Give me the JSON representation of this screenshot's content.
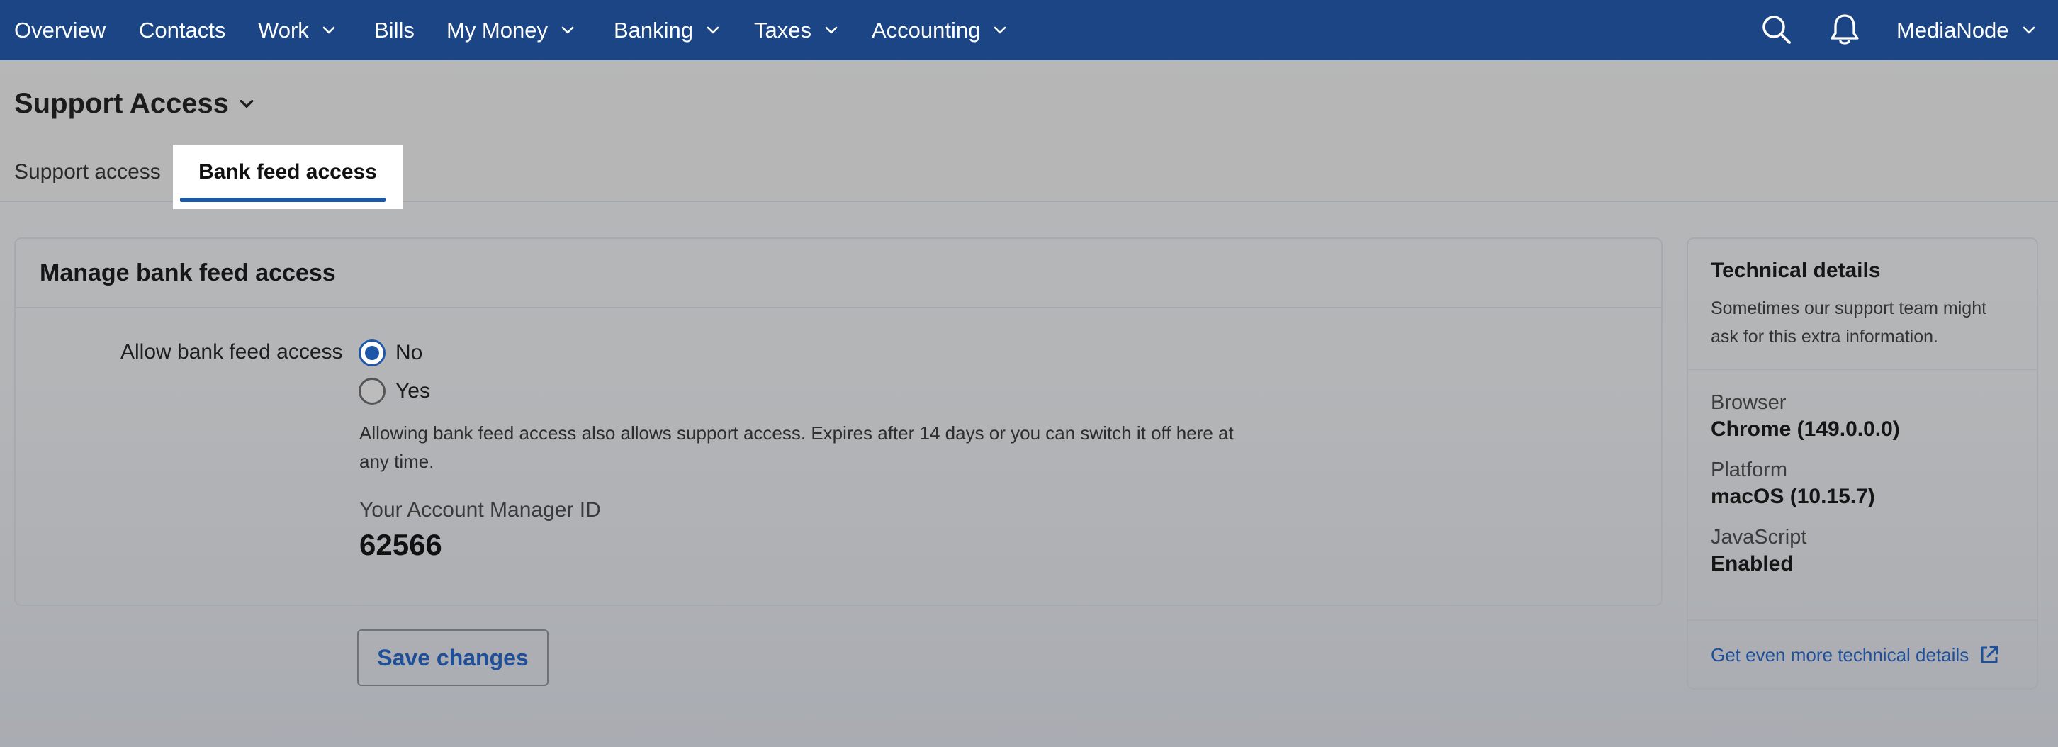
{
  "nav": {
    "items": [
      {
        "label": "Overview",
        "dropdown": false
      },
      {
        "label": "Contacts",
        "dropdown": false
      },
      {
        "label": "Work",
        "dropdown": true
      },
      {
        "label": "Bills",
        "dropdown": false
      },
      {
        "label": "My Money",
        "dropdown": true
      },
      {
        "label": "Banking",
        "dropdown": true
      },
      {
        "label": "Taxes",
        "dropdown": true
      },
      {
        "label": "Accounting",
        "dropdown": true
      }
    ],
    "account_label": "MediaNode",
    "icons": [
      "search-icon",
      "bell-icon",
      "chevron-down-icon"
    ],
    "bg_color": "#1b4585"
  },
  "page": {
    "title": "Support Access"
  },
  "tabs": [
    {
      "label": "Support access",
      "active": false
    },
    {
      "label": "Bank feed access",
      "active": true
    }
  ],
  "card": {
    "heading": "Manage bank feed access",
    "field_label": "Allow bank feed access",
    "options": [
      {
        "label": "No",
        "checked": true
      },
      {
        "label": "Yes",
        "checked": false
      }
    ],
    "help_text": "Allowing bank feed access also allows support access. Expires after 14 days or you can switch it off here at any time.",
    "account_manager_label": "Your Account Manager ID",
    "account_manager_id": "62566"
  },
  "save_label": "Save changes",
  "technical": {
    "title": "Technical details",
    "description": "Sometimes our support team might ask for this extra information.",
    "details": [
      {
        "key": "Browser",
        "value": "Chrome (149.0.0.0)"
      },
      {
        "key": "Platform",
        "value": "macOS (10.15.7)"
      },
      {
        "key": "JavaScript",
        "value": "Enabled"
      }
    ],
    "link_label": "Get even more technical details"
  },
  "colors": {
    "accent": "#1f57a8",
    "link": "#1f4f99"
  }
}
